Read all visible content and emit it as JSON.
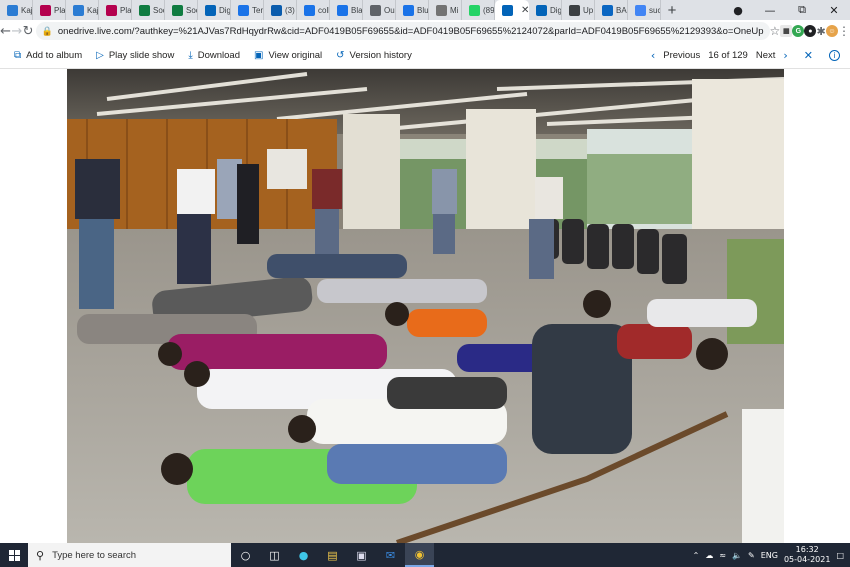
{
  "browser": {
    "tabs": [
      {
        "label": "Kaj",
        "icon": "edit-icon",
        "color": "#2b7cd3"
      },
      {
        "label": "Pla",
        "icon": "m-logo-icon",
        "color": "#b4004e"
      },
      {
        "label": "Kaj",
        "icon": "edit-icon",
        "color": "#2b7cd3"
      },
      {
        "label": "Pla",
        "icon": "m-logo-icon",
        "color": "#b4004e"
      },
      {
        "label": "Soc",
        "icon": "excel-icon",
        "color": "#107c41"
      },
      {
        "label": "Soc",
        "icon": "excel-icon",
        "color": "#107c41"
      },
      {
        "label": "Dig",
        "icon": "cloud-icon",
        "color": "#0364b8"
      },
      {
        "label": "Ten",
        "icon": "g-circle-icon",
        "color": "#1a73e8"
      },
      {
        "label": "(3)",
        "icon": "box-icon",
        "color": "#0b5cad"
      },
      {
        "label": "coll",
        "icon": "g-circle-icon",
        "color": "#1a73e8"
      },
      {
        "label": "Bla",
        "icon": "g-circle-icon",
        "color": "#1a73e8"
      },
      {
        "label": "Ou",
        "icon": "person-icon",
        "color": "#5f6368"
      },
      {
        "label": "Blu",
        "icon": "g-circle-icon",
        "color": "#1a73e8"
      },
      {
        "label": "Mi",
        "icon": "ms-icon",
        "color": "#737373"
      },
      {
        "label": "(89",
        "icon": "whatsapp-icon",
        "color": "#25d366"
      },
      {
        "label": "",
        "icon": "cloud-icon",
        "color": "#0364b8",
        "active": true
      },
      {
        "label": "Dig",
        "icon": "cloud-icon",
        "color": "#0364b8"
      },
      {
        "label": "Up",
        "icon": "cap-icon",
        "color": "#3c4043"
      },
      {
        "label": "BAI",
        "icon": "linkedin-icon",
        "color": "#0a66c2"
      },
      {
        "label": "suc",
        "icon": "google-icon",
        "color": "#4285f4"
      }
    ],
    "new_tab": "+",
    "url": "onedrive.live.com/?authkey=%21AJVas7RdHqydrRw&cid=ADF0419B05F69655&id=ADF0419B05F69655%2124072&parId=ADF0419B05F69655%2129393&o=OneUp"
  },
  "onedrive": {
    "commands": [
      {
        "label": "Add to album",
        "icon": "album-icon",
        "glyph": "⧉"
      },
      {
        "label": "Play slide show",
        "icon": "play-icon",
        "glyph": "▷"
      },
      {
        "label": "Download",
        "icon": "download-icon",
        "glyph": "⤓"
      },
      {
        "label": "View original",
        "icon": "image-icon",
        "glyph": "▣"
      },
      {
        "label": "Version history",
        "icon": "history-icon",
        "glyph": "↺"
      }
    ],
    "previous": "Previous",
    "position": "16 of 129",
    "next": "Next"
  },
  "taskbar": {
    "search_placeholder": "Type here to search",
    "language": "ENG",
    "time": "16:32",
    "date": "05-04-2021"
  }
}
